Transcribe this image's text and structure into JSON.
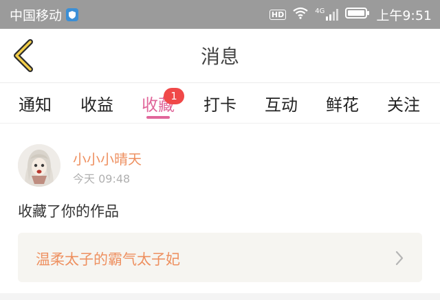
{
  "status_bar": {
    "carrier": "中国移动",
    "network_badge": "HD",
    "signal_label": "4G",
    "time": "上午9:51",
    "icons": [
      "shield-icon",
      "wifi-icon",
      "signal-icon",
      "battery-icon"
    ]
  },
  "nav": {
    "title": "消息",
    "back_icon": "chevron-left-icon"
  },
  "tabs": [
    {
      "label": "通知"
    },
    {
      "label": "收益"
    },
    {
      "label": "收藏",
      "active": true,
      "badge": "1"
    },
    {
      "label": "打卡"
    },
    {
      "label": "互动"
    },
    {
      "label": "鲜花"
    },
    {
      "label": "关注"
    }
  ],
  "message": {
    "user_name": "小小小晴天",
    "time": "今天 09:48",
    "text": "收藏了你的作品",
    "work_title": "温柔太子的霸气太子妃"
  },
  "colors": {
    "accent": "#e0669a",
    "name": "#ee9060",
    "badge": "#f04848",
    "status_bar": "#9b9b9b",
    "card_bg": "#f6f5f1",
    "back_arrow_fill": "#f4cf4a"
  }
}
